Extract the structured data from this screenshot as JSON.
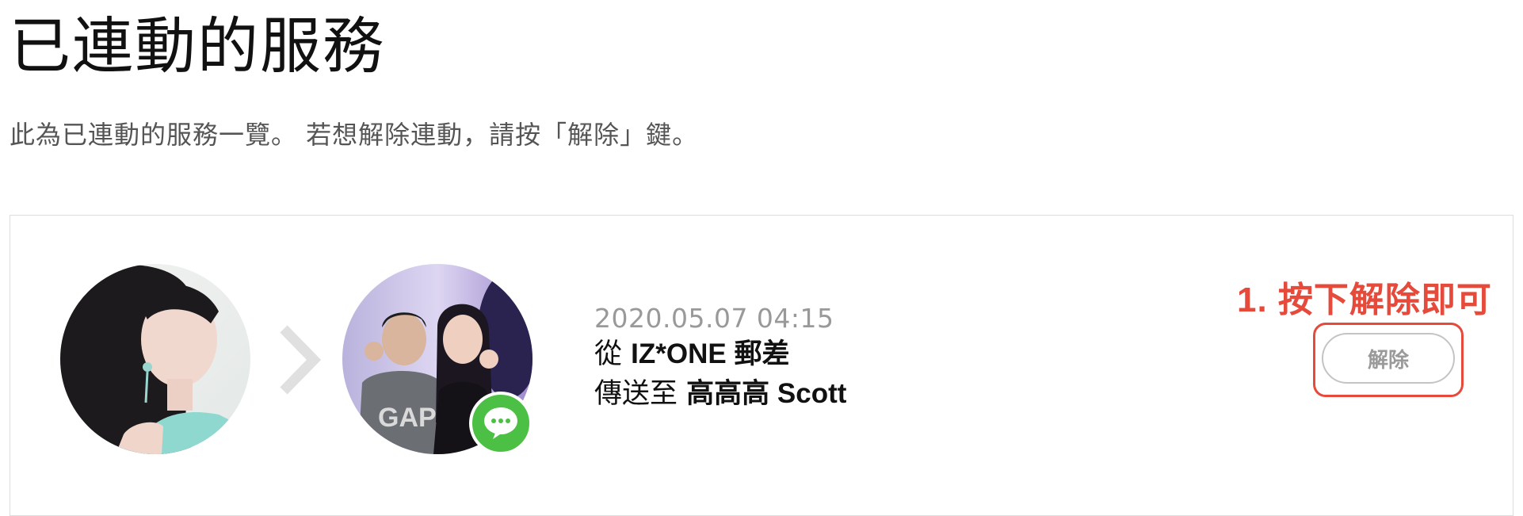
{
  "page": {
    "title": "已連動的服務",
    "description": "此為已連動的服務一覽。 若想解除連動，請按「解除」鍵。"
  },
  "connection": {
    "date": "2020.05.07 04:15",
    "from_prefix": "從",
    "from_name": "IZ*ONE 郵差",
    "to_prefix": "傳送至",
    "to_name": "高高高 Scott",
    "unlink_label": "解除"
  },
  "annotation": {
    "text": "1. 按下解除即可",
    "color": "#e64a3b"
  },
  "icons": {
    "arrow": "chevron-right-icon",
    "badge": "line-chat-bubble-icon"
  },
  "colors": {
    "line_green": "#4cbf45",
    "annotation_red": "#e64a3b",
    "button_border": "#c4c4c4"
  }
}
